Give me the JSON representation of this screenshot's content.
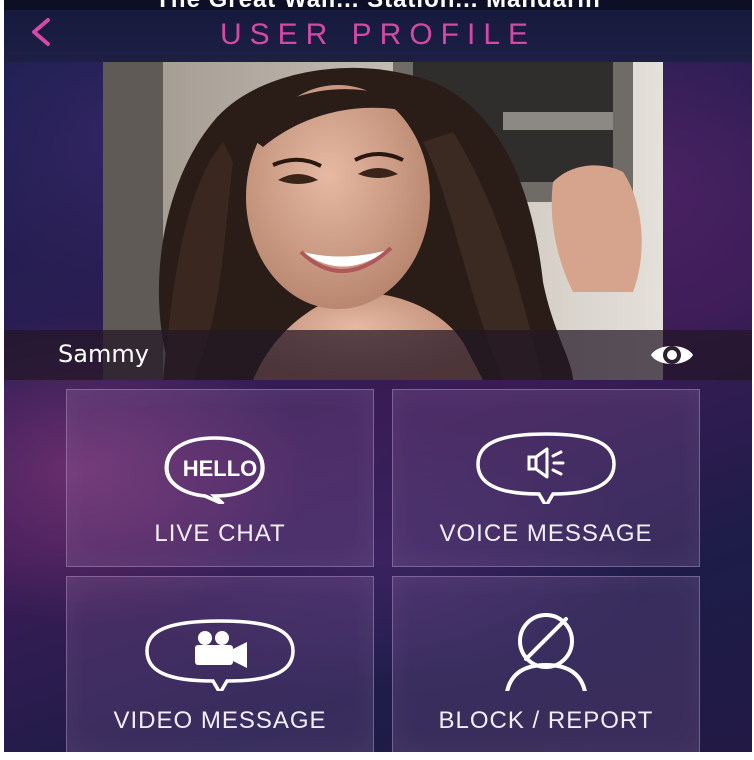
{
  "header": {
    "status_text": "The Great Wall... Station... Mandarin",
    "title": "USER PROFILE",
    "back_icon": "chevron-left-icon"
  },
  "profile": {
    "name": "Sammy",
    "view_icon": "eye-icon"
  },
  "actions": [
    {
      "label": "LIVE CHAT",
      "icon": "hello-speech-bubble-icon",
      "badge_text": "HELLO"
    },
    {
      "label": "VOICE MESSAGE",
      "icon": "speaker-speech-bubble-icon"
    },
    {
      "label": "VIDEO MESSAGE",
      "icon": "video-camera-speech-bubble-icon"
    },
    {
      "label": "BLOCK / REPORT",
      "icon": "blocked-user-icon"
    }
  ],
  "colors": {
    "title_accent": "#d24aa6",
    "background": "#2a1d52"
  }
}
